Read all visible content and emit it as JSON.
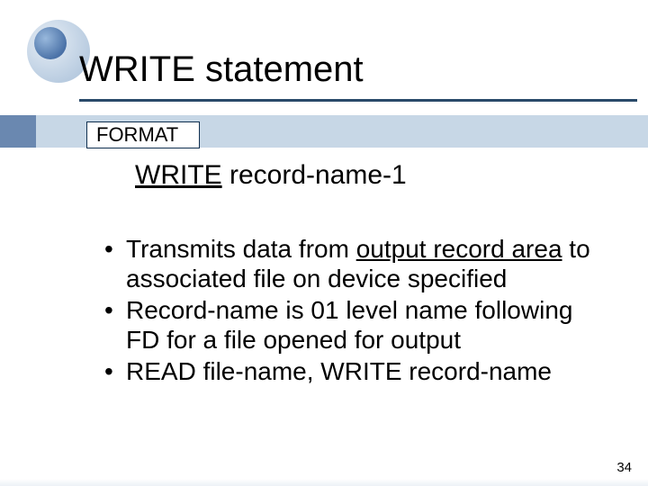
{
  "title": "WRITE statement",
  "format_label": "FORMAT",
  "syntax": {
    "keyword": "WRITE",
    "rest": " record-name-1"
  },
  "bullets": [
    {
      "pre": "Transmits data from ",
      "u": "output record area",
      "post": " to associated file on device specified"
    },
    {
      "pre": "Record-name is 01 level name following FD for a file opened for output",
      "u": "",
      "post": ""
    },
    {
      "pre": "READ file-name, WRITE record-name",
      "u": "",
      "post": ""
    }
  ],
  "page_number": "34"
}
